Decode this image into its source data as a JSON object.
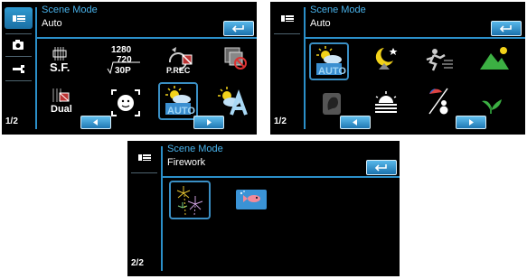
{
  "screens": [
    {
      "title": "Scene Mode",
      "value": "Auto",
      "page": "1/2",
      "icons": [
        "image-stabilization-icon",
        "resolution-icon",
        "pre-record-icon",
        "anti-theft-icon",
        "dual-record-icon",
        "face-detection-icon",
        "auto-scene-icon",
        "auto-white-balance-icon"
      ],
      "resolution": [
        "1280",
        "720",
        "30P"
      ],
      "sf_label": "S.F.",
      "prec_label": "P.REC",
      "dual_label": "Dual",
      "auto_label": "AUTO"
    },
    {
      "title": "Scene Mode",
      "value": "Auto",
      "page": "1/2",
      "icons": [
        "auto-scene-icon",
        "night-scene-icon",
        "sports-scene-icon",
        "landscape-scene-icon",
        "portrait-scene-icon",
        "sunset-scene-icon",
        "beach-snow-scene-icon",
        "plant-macro-scene-icon"
      ],
      "auto_label": "AUTO"
    },
    {
      "title": "Scene Mode",
      "value": "Firework",
      "page": "2/2",
      "icons": [
        "firework-scene-icon",
        "aquarium-scene-icon"
      ]
    }
  ],
  "colors": {
    "accent": "#2b8fc9",
    "title": "#49b3ec",
    "screen_bg": "#000000",
    "button": "#1f78b3"
  }
}
